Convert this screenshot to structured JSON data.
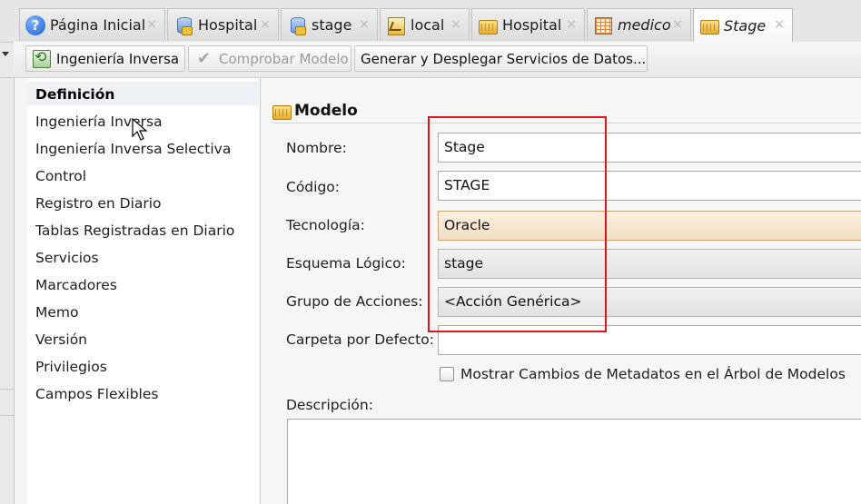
{
  "tabs": [
    {
      "label": "Página Inicial",
      "icon": "help-icon",
      "italic": false
    },
    {
      "label": "Hospital",
      "icon": "database-folder-icon",
      "italic": false
    },
    {
      "label": "stage",
      "icon": "database-folder-icon",
      "italic": false
    },
    {
      "label": "local",
      "icon": "local-file-icon",
      "italic": false
    },
    {
      "label": "Hospital",
      "icon": "model-folder-icon",
      "italic": false
    },
    {
      "label": "medico",
      "icon": "table-icon",
      "italic": true
    },
    {
      "label": "Stage",
      "icon": "model-folder-icon",
      "italic": true,
      "active": true
    }
  ],
  "tab_close_glyph": "×",
  "toolbar": {
    "reverse_engineering": "Ingeniería Inversa",
    "check_model": "Comprobar Modelo",
    "generate_services": "Generar y Desplegar Servicios de Datos..."
  },
  "nav": {
    "items": [
      "Definición",
      "Ingeniería Inversa",
      "Ingeniería Inversa Selectiva",
      "Control",
      "Registro en Diario",
      "Tablas Registradas en Diario",
      "Servicios",
      "Marcadores",
      "Memo",
      "Versión",
      "Privilegios",
      "Campos Flexibles"
    ],
    "selected": "Definición"
  },
  "section_title": "Modelo",
  "form": {
    "nombre": {
      "label": "Nombre:",
      "value": "Stage"
    },
    "codigo": {
      "label": "Código:",
      "value": "STAGE"
    },
    "tecnologia": {
      "label": "Tecnología:",
      "value": "Oracle"
    },
    "esquema": {
      "label": "Esquema Lógico:",
      "value": "stage"
    },
    "grupo": {
      "label": "Grupo de Acciones:",
      "value": "<Acción Genérica>"
    },
    "carpeta": {
      "label": "Carpeta por Defecto:",
      "value": ""
    },
    "mostrar_cambios": {
      "label": "Mostrar Cambios de Metadatos en el Árbol de Modelos",
      "checked": false
    },
    "descripcion": {
      "label": "Descripción:",
      "value": ""
    }
  },
  "colors": {
    "annotation_box": "#e0141c",
    "highlighted_combo": "#f1dcc2"
  }
}
